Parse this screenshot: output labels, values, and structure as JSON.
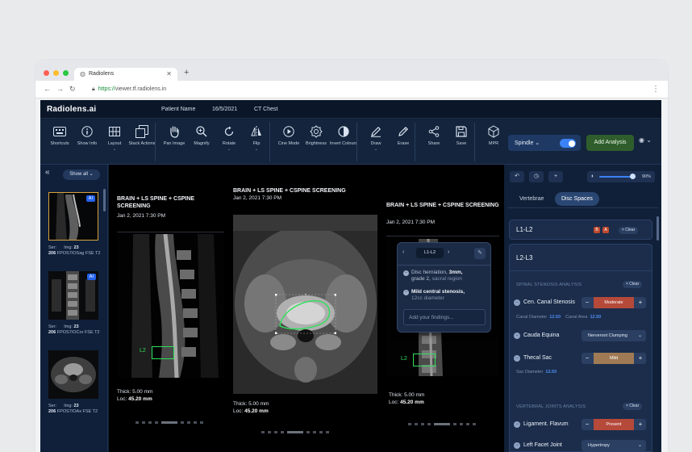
{
  "browser": {
    "tab_title": "Radiolens",
    "new_tab": "+",
    "url_proto": "https://",
    "url_host": "viewer.tf.radiolens.in",
    "dot_colors": [
      "#ff5f57",
      "#febc2e",
      "#28c840"
    ]
  },
  "app": {
    "brand": "Radiolens.ai",
    "patient": {
      "name_label": "Patient Name",
      "date": "16/5/2021",
      "study": "CT Chest"
    }
  },
  "toolbar": {
    "tools": [
      {
        "label": "Shortcuts",
        "icon": "keyboard-icon"
      },
      {
        "label": "Show Info",
        "icon": "info-icon"
      },
      {
        "label": "Layout",
        "icon": "grid-icon",
        "dropdown": true
      },
      {
        "label": "Stack Actions",
        "icon": "stack-icon"
      },
      {
        "label": "Pan Image",
        "icon": "hand-icon"
      },
      {
        "label": "Magnify",
        "icon": "magnify-icon"
      },
      {
        "label": "Rotate",
        "icon": "rotate-icon",
        "dropdown": true
      },
      {
        "label": "Flip",
        "icon": "flip-icon",
        "dropdown": true
      },
      {
        "label": "Cine Mode",
        "icon": "play-icon"
      },
      {
        "label": "Brightness",
        "icon": "brightness-icon"
      },
      {
        "label": "Invert Colours",
        "icon": "invert-icon"
      },
      {
        "label": "Draw",
        "icon": "pen-icon",
        "dropdown": true
      },
      {
        "label": "Erase",
        "icon": "eraser-icon"
      },
      {
        "label": "Share",
        "icon": "share-icon"
      },
      {
        "label": "Save",
        "icon": "save-icon"
      },
      {
        "label": "MPR",
        "icon": "cube-icon"
      }
    ],
    "spindle_label": "Spindle",
    "spindle_on": true,
    "add_analysis": "Add Analysis",
    "accent": "#3b82f6",
    "add_color": "#2f5e2c"
  },
  "left": {
    "show_all": "Show all",
    "thumbs": [
      {
        "ai": "AI",
        "ser": "Ser:",
        "img_label": "Img:",
        "img": "23",
        "ser_num": "206",
        "desc": "FPOS7/OSag FSE T2",
        "selected": true
      },
      {
        "ai": "AI",
        "ser": "Ser:",
        "img_label": "Img:",
        "img": "23",
        "ser_num": "206",
        "desc": "FPOS7/OCor FSE T2",
        "selected": false
      },
      {
        "ai": "",
        "ser": "Ser:",
        "img_label": "Img:",
        "img": "23",
        "ser_num": "206",
        "desc": "FPOS7/OAx FSE T2",
        "selected": false
      }
    ]
  },
  "viewports": [
    {
      "title": "BRAIN + LS SPINE + CSPINE SCREENING",
      "date": "Jan 2, 2021 7:30 PM",
      "thick": "Thick: 5.00 mm",
      "loc_label": "Loc:",
      "loc": "45.20 mm",
      "roi_label": "L2"
    },
    {
      "title": "BRAIN + LS SPINE + CSPINE SCREENING",
      "date": "Jan 2, 2021 7:30 PM",
      "thick": "Thick: 5.00 mm",
      "loc_label": "Loc:",
      "loc": "45.20 mm"
    },
    {
      "title": "BRAIN + LS SPINE + CSPINE SCREENING",
      "date": "Jan 2, 2021 7:30 PM",
      "thick": "Thick: 5.00 mm",
      "loc_label": "Loc:",
      "loc": "45.20 mm",
      "roi_label": "L2"
    }
  ],
  "popover": {
    "level": "L1-L2",
    "findings": [
      {
        "pre": "Disc herniation,",
        "strong": "3mm,",
        "mid": "grade 2,",
        "sub": "sacral region"
      },
      {
        "pre": "",
        "strong": "Mild central stenosis,",
        "mid": "",
        "sub": "12cc diameter"
      }
    ],
    "placeholder": "Add your findings..."
  },
  "right": {
    "brightness_pct": "90%",
    "brightness_value": 0.9,
    "tabs": [
      {
        "label": "Vertebrae",
        "active": false
      },
      {
        "label": "Disc Spaces",
        "active": true
      }
    ],
    "l1": {
      "title": "L1-L2",
      "badges": [
        "B",
        "A"
      ],
      "clear": "× Clear"
    },
    "l2": {
      "title": "L2-L3",
      "sections": [
        {
          "name": "SPINAL STENOSIS ANALYSIS",
          "clear": "× Clear",
          "rows": [
            {
              "label": "Cen. Canal Stenosis",
              "type": "stepper",
              "value": "Moderate",
              "color": "#b5493a"
            },
            {
              "label": "Cauda Equina",
              "type": "select",
              "value": "Nerveroot Clumping"
            },
            {
              "label": "Thecal Sac",
              "type": "stepper",
              "value": "Mild",
              "color": "#a07a55"
            }
          ],
          "meta1": {
            "a_label": "Canal Diameter",
            "a": "12.50",
            "b_label": "Canal Area",
            "b": "12.50"
          },
          "meta2": {
            "a_label": "Sac Diameter",
            "a": "12.50"
          }
        },
        {
          "name": "VERTEBRAL JOINTS ANALYSIS",
          "clear": "× Clear",
          "rows": [
            {
              "label": "Ligament. Flavum",
              "type": "stepper",
              "value": "Present",
              "color": "#b5493a"
            },
            {
              "label": "Left Facet Joint",
              "type": "select",
              "value": "Hypertropy"
            }
          ]
        }
      ]
    }
  }
}
